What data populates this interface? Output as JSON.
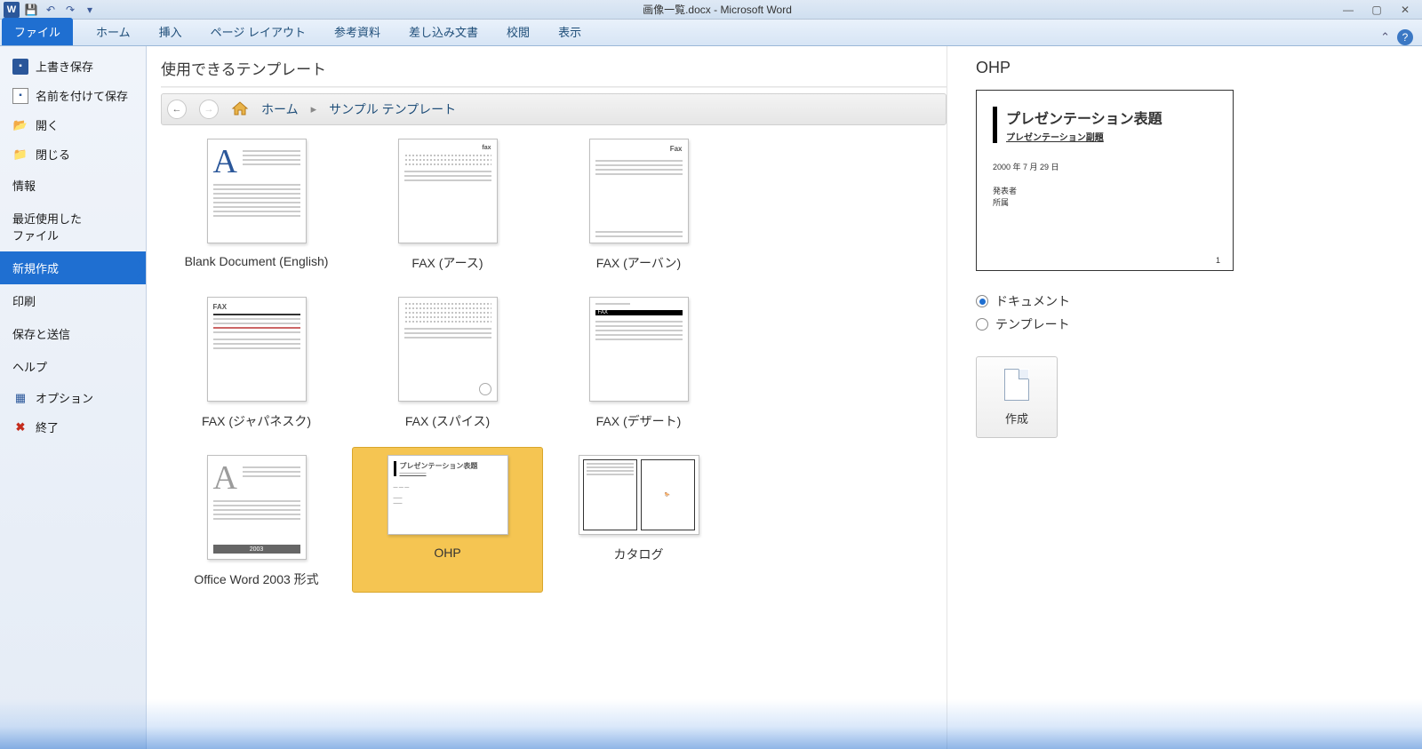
{
  "titlebar": {
    "document": "画像一覧.docx",
    "app": "Microsoft Word"
  },
  "qat": {
    "save": "保存",
    "undo": "元に戻す",
    "redo": "やり直し"
  },
  "win": {
    "min": "最小化",
    "max": "最大化",
    "close": "閉じる"
  },
  "tabs": {
    "file": "ファイル",
    "home": "ホーム",
    "insert": "挿入",
    "layout": "ページ レイアウト",
    "ref": "参考資料",
    "mail": "差し込み文書",
    "review": "校閲",
    "view": "表示"
  },
  "nav": {
    "save": "上書き保存",
    "saveas": "名前を付けて保存",
    "open": "開く",
    "close": "閉じる",
    "info": "情報",
    "recent": "最近使用した\nファイル",
    "new": "新規作成",
    "print": "印刷",
    "share": "保存と送信",
    "help": "ヘルプ",
    "options": "オプション",
    "exit": "終了"
  },
  "pane": {
    "title": "使用できるテンプレート"
  },
  "breadcrumb": {
    "home": "ホーム",
    "sample": "サンプル テンプレート"
  },
  "templates": [
    {
      "label": "Blank Document (English)"
    },
    {
      "label": "FAX (アース)"
    },
    {
      "label": "FAX (アーバン)"
    },
    {
      "label": "FAX (ジャパネスク)"
    },
    {
      "label": "FAX (スパイス)"
    },
    {
      "label": "FAX (デザート)"
    },
    {
      "label": "Office Word 2003 形式"
    },
    {
      "label": "OHP"
    },
    {
      "label": "カタログ"
    }
  ],
  "preview": {
    "title": "OHP",
    "slide_title": "プレゼンテーション表題",
    "slide_sub": "プレゼンテーション副題",
    "slide_date": "2000 年 7 月 29 日",
    "slide_author1": "発表者",
    "slide_author2": "所属",
    "slide_page": "1",
    "radio_doc": "ドキュメント",
    "radio_tpl": "テンプレート",
    "create": "作成"
  },
  "thumb2003": "2003",
  "ohp_thumb_title": "プレゼンテーション表題"
}
